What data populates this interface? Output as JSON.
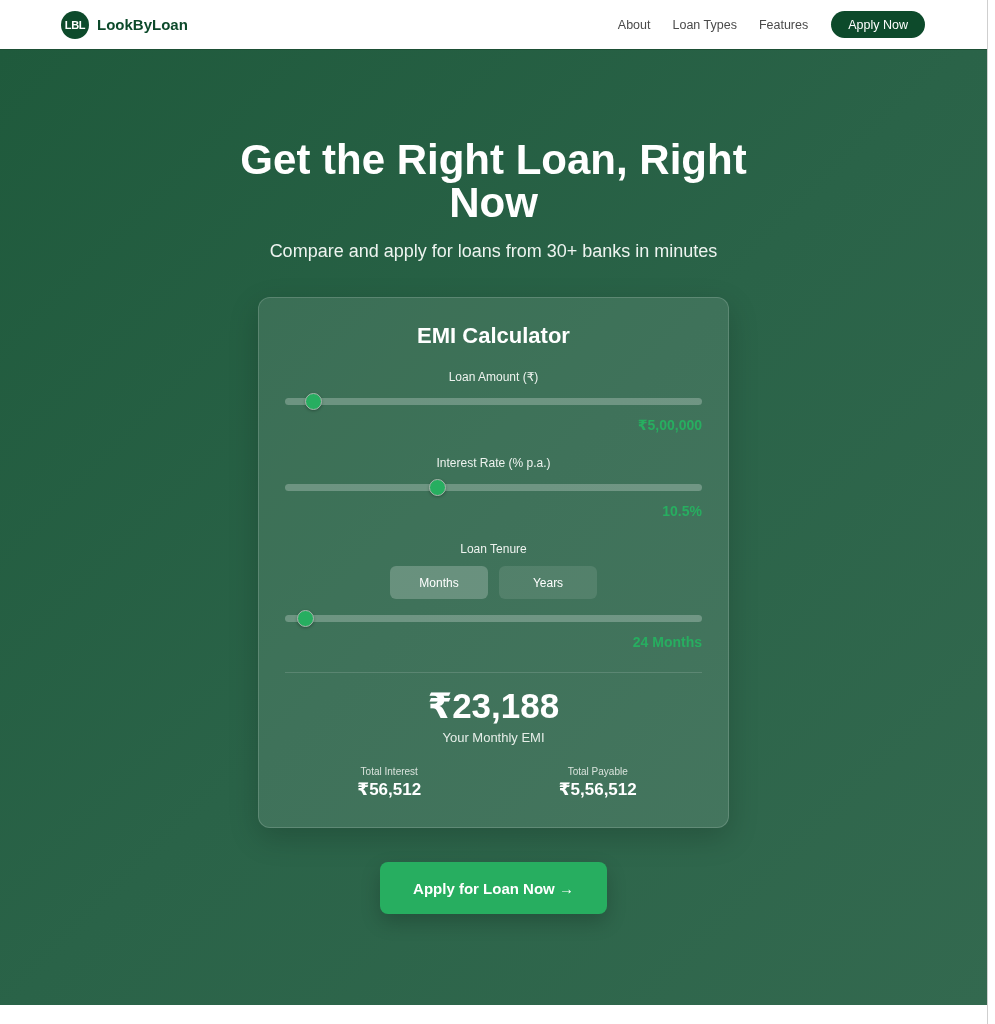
{
  "header": {
    "logo": {
      "mark": "LBL",
      "name": "LookByLoan"
    },
    "nav": [
      {
        "label": "About"
      },
      {
        "label": "Loan Types"
      },
      {
        "label": "Features"
      }
    ],
    "cta": "Apply Now"
  },
  "hero": {
    "title": "Get the Right Loan, Right Now",
    "subtitle": "Compare and apply for loans from 30+ banks in minutes"
  },
  "calculator": {
    "title": "EMI Calculator",
    "inputs": [
      {
        "label": "Loan Amount (₹)",
        "level": 0.05,
        "reading": "₹5,00,000"
      },
      {
        "label": "Interest Rate (% p.a.)",
        "level": 0.36,
        "reading": "10.5%"
      },
      {
        "label": "Loan Tenure",
        "options": [
          {
            "label": "Months",
            "selected": true
          },
          {
            "label": "Years",
            "selected": false
          }
        ],
        "level": 0.03,
        "reading": "24 Months"
      }
    ],
    "result": {
      "emi": "₹23,188",
      "emi_label": "Your Monthly EMI",
      "totals": [
        {
          "label": "Total Interest",
          "value": "₹56,512"
        },
        {
          "label": "Total Payable",
          "value": "₹5,56,512"
        }
      ]
    }
  },
  "apply_button": "Apply for Loan Now →"
}
